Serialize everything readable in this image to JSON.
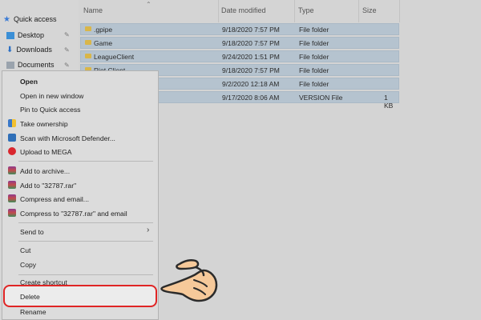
{
  "nav": {
    "items": [
      {
        "label": "Quick access",
        "icon": "star-icon"
      },
      {
        "label": "Desktop",
        "icon": "desktop-icon"
      },
      {
        "label": "Downloads",
        "icon": "download-icon"
      },
      {
        "label": "Documents",
        "icon": "documents-icon"
      }
    ]
  },
  "columns": {
    "name": "Name",
    "date": "Date modified",
    "type": "Type",
    "size": "Size"
  },
  "files": [
    {
      "name": ".gpipe",
      "date": "9/18/2020 7:57 PM",
      "type": "File folder",
      "size": ""
    },
    {
      "name": "Game",
      "date": "9/18/2020 7:57 PM",
      "type": "File folder",
      "size": ""
    },
    {
      "name": "LeagueClient",
      "date": "9/24/2020 1:51 PM",
      "type": "File folder",
      "size": ""
    },
    {
      "name": "Riot Client",
      "date": "9/18/2020 7:57 PM",
      "type": "File folder",
      "size": ""
    },
    {
      "name": "",
      "date": "9/2/2020 12:18 AM",
      "type": "File folder",
      "size": ""
    },
    {
      "name": "",
      "date": "9/17/2020 8:06 AM",
      "type": "VERSION File",
      "size": "1 KB"
    }
  ],
  "menu": {
    "open": "Open",
    "open_new_window": "Open in new window",
    "pin_quick": "Pin to Quick access",
    "take_ownership": "Take ownership",
    "scan_defender": "Scan with Microsoft Defender...",
    "upload_mega": "Upload to MEGA",
    "add_archive": "Add to archive...",
    "add_rar": "Add to \"32787.rar\"",
    "compress_email": "Compress and email...",
    "compress_rar_email": "Compress to \"32787.rar\" and email",
    "send_to": "Send to",
    "cut": "Cut",
    "copy": "Copy",
    "create_shortcut": "Create shortcut",
    "delete": "Delete",
    "rename": "Rename"
  },
  "colors": {
    "highlight": "#e02525",
    "selection": "#b5c3cf",
    "hand": "#f6c99a"
  }
}
